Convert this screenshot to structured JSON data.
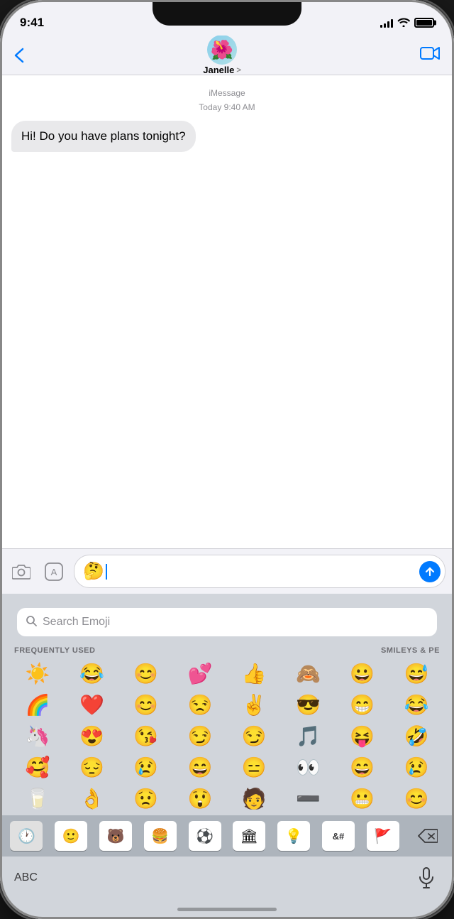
{
  "status_bar": {
    "time": "9:41",
    "signal_bars": [
      4,
      6,
      8,
      11,
      14
    ],
    "battery_label": "battery"
  },
  "nav": {
    "back_label": "<",
    "contact_name": "Janelle",
    "contact_chevron": ">",
    "video_icon": "video-camera",
    "contact_avatar_emoji": "🌺"
  },
  "message_header": {
    "service": "iMessage",
    "timestamp": "Today 9:40 AM"
  },
  "message": {
    "text": "Hi! Do you have plans tonight?"
  },
  "input": {
    "text_emoji": "🤔",
    "cursor": true,
    "camera_icon": "camera",
    "app_icon": "app-store",
    "send_icon": "send-arrow"
  },
  "emoji_keyboard": {
    "search_placeholder": "Search Emoji",
    "section_frequently": "FREQUENTLY USED",
    "section_smileys": "SMILEYS & PE",
    "emojis_row1": [
      "☀️",
      "😂",
      "😊",
      "💕",
      "👍",
      "🙈",
      "😀",
      "😅"
    ],
    "emojis_row2": [
      "🌈",
      "❤️",
      "😊",
      "😒",
      "✌️",
      "😎",
      "😁",
      "😂"
    ],
    "emojis_row3": [
      "🦄",
      "😍",
      "😘",
      "😏",
      "😏",
      "🎵",
      "😝",
      "🤣"
    ],
    "emojis_row4": [
      "🥰",
      "😔",
      "😢",
      "😄",
      "😑",
      "👀",
      "😄",
      "😢"
    ],
    "emojis_row5": [
      "🥛",
      "👌",
      "😟",
      "😲",
      "🧑",
      "➖",
      "😬",
      "😊"
    ]
  },
  "keyboard_bar": {
    "clock_icon": "clock",
    "smiley_icon": "smiley",
    "animal_icon": "animal",
    "food_icon": "food",
    "sports_icon": "sports",
    "buildings_icon": "buildings",
    "objects_icon": "objects",
    "symbols_icon": "symbols",
    "flags_icon": "flags",
    "delete_icon": "delete"
  },
  "bottom_bar": {
    "abc_label": "ABC",
    "mic_icon": "microphone"
  }
}
